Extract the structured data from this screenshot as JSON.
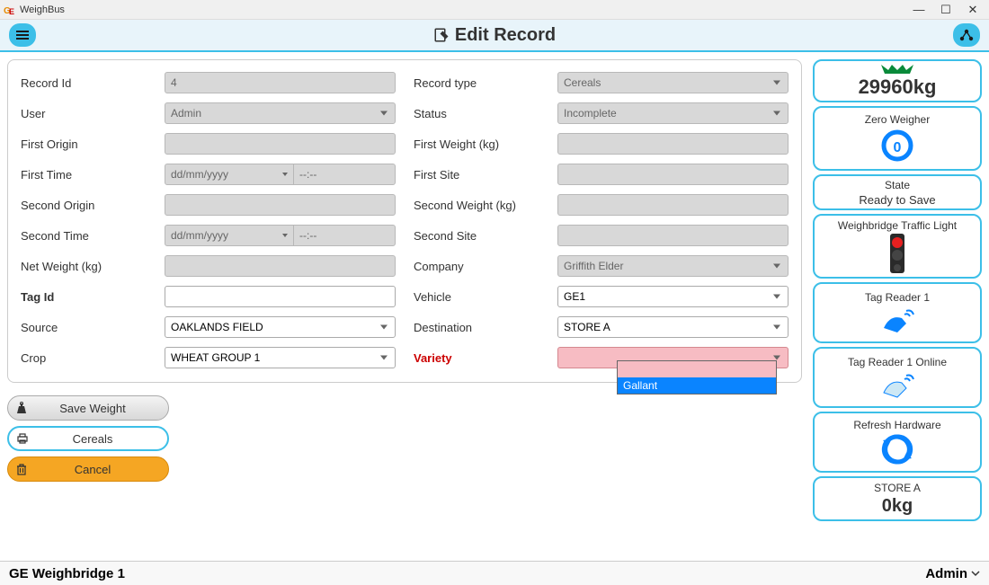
{
  "window": {
    "title": "WeighBus"
  },
  "header": {
    "title": "Edit Record"
  },
  "form": {
    "left": {
      "record_id": {
        "label": "Record Id",
        "value": "4"
      },
      "user": {
        "label": "User",
        "value": "Admin"
      },
      "first_origin": {
        "label": "First Origin",
        "value": ""
      },
      "first_time": {
        "label": "First Time",
        "date": "dd/mm/yyyy",
        "time": "--:--"
      },
      "second_origin": {
        "label": "Second Origin",
        "value": ""
      },
      "second_time": {
        "label": "Second Time",
        "date": "dd/mm/yyyy",
        "time": "--:--"
      },
      "net_weight": {
        "label": "Net Weight (kg)",
        "value": ""
      },
      "tag_id": {
        "label": "Tag Id",
        "value": ""
      },
      "source": {
        "label": "Source",
        "value": "OAKLANDS FIELD"
      },
      "crop": {
        "label": "Crop",
        "value": "WHEAT GROUP 1"
      }
    },
    "right": {
      "record_type": {
        "label": "Record type",
        "value": "Cereals"
      },
      "status": {
        "label": "Status",
        "value": "Incomplete"
      },
      "first_weight": {
        "label": "First Weight (kg)",
        "value": ""
      },
      "first_site": {
        "label": "First Site",
        "value": ""
      },
      "second_weight": {
        "label": "Second Weight (kg)",
        "value": ""
      },
      "second_site": {
        "label": "Second Site",
        "value": ""
      },
      "company": {
        "label": "Company",
        "value": "Griffith Elder"
      },
      "vehicle": {
        "label": "Vehicle",
        "value": "GE1"
      },
      "destination": {
        "label": "Destination",
        "value": "STORE A"
      },
      "variety": {
        "label": "Variety",
        "value": "",
        "options": [
          "",
          "Gallant"
        ]
      }
    }
  },
  "dropdown": {
    "blank": "",
    "selected": "Gallant"
  },
  "actions": {
    "save": "Save Weight",
    "cereals": "Cereals",
    "cancel": "Cancel"
  },
  "sidebar": {
    "weight": "29960kg",
    "zero": "Zero Weigher",
    "state_title": "State",
    "state_value": "Ready to Save",
    "traffic": "Weighbridge Traffic Light",
    "tag1": "Tag Reader 1",
    "tag1online": "Tag Reader 1 Online",
    "refresh": "Refresh Hardware",
    "store_name": "STORE A",
    "store_weight": "0kg"
  },
  "footer": {
    "left": "GE Weighbridge 1",
    "right": "Admin"
  }
}
